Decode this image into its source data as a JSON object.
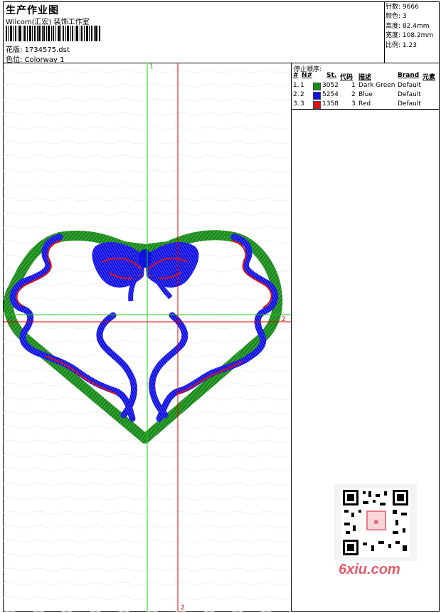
{
  "header": {
    "title": "生产作业图",
    "studio": "Wilcom(汇宏) 装饰工作室",
    "design_label": "花版:",
    "design_value": "1734575.dst",
    "colorway_label": "色位:",
    "colorway_value": "Colorway 1"
  },
  "stats": {
    "stitches_label": "针数:",
    "stitches_value": "9666",
    "colors_label": "颜色:",
    "colors_value": "3",
    "height_label": "高度:",
    "height_value": "82.4mm",
    "width_label": "宽度:",
    "width_value": "108.2mm",
    "ratio_label": "比例:",
    "ratio_value": "1.23"
  },
  "axes": {
    "green_top": "1",
    "green_left": "1",
    "red_right": "2",
    "red_bottom": "2"
  },
  "stop_sequence": {
    "title": "停止顺序:",
    "headers": {
      "hash": "#",
      "n": "N#",
      "st": "St.",
      "code": "代码",
      "desc": "描述",
      "brand": "Brand",
      "element": "元素"
    },
    "rows": [
      {
        "idx": "1.",
        "n": "1",
        "color": "#1a8a1a",
        "st": "3052",
        "code": "1",
        "desc": "Dark Green",
        "brand": "Default"
      },
      {
        "idx": "2.",
        "n": "2",
        "color": "#1010e0",
        "st": "5254",
        "code": "2",
        "desc": "Blue",
        "brand": "Default"
      },
      {
        "idx": "3.",
        "n": "3",
        "color": "#e01010",
        "st": "1358",
        "code": "3",
        "desc": "Red",
        "brand": "Default"
      }
    ]
  },
  "watermark": "6xiu.com",
  "colors": {
    "green": "#1a8a1a",
    "blue": "#1010e0",
    "red": "#e01010",
    "axis_green": "#22cc22",
    "axis_red": "#dd0000"
  }
}
